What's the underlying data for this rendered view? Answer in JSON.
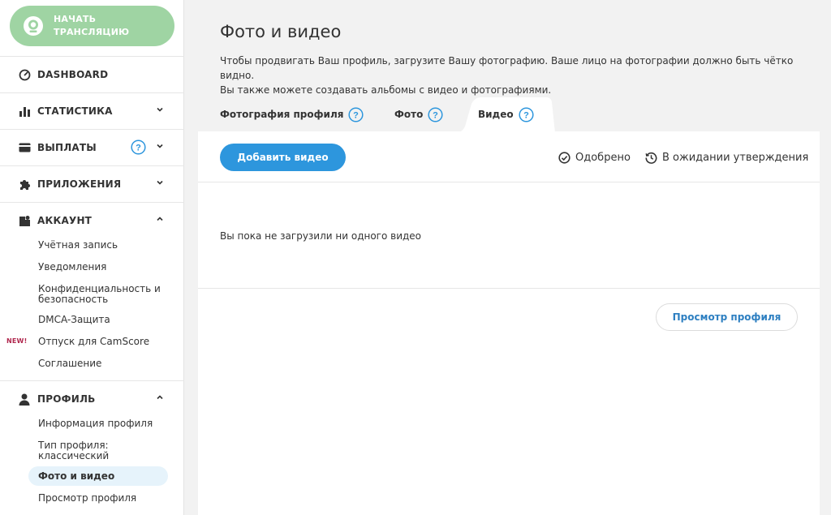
{
  "sidebar": {
    "stream_button": {
      "line1": "НАЧАТЬ",
      "line2": "ТРАНСЛЯЦИЮ"
    },
    "sections": {
      "dashboard": "DASHBOARD",
      "stats": "СТАТИСТИКА",
      "payouts": "ВЫПЛАТЫ",
      "apps": "ПРИЛОЖЕНИЯ",
      "account": "АККАУНТ",
      "profile": "ПРОФИЛЬ"
    },
    "account_items": {
      "account": "Учётная запись",
      "notifications": "Уведомления",
      "privacy_line1": "Конфиденциальность и",
      "privacy_line2": "безопасность",
      "dmca": "DMCA-Защита",
      "camscore": "Отпуск для CamScore",
      "agreement": "Соглашение"
    },
    "new_badge": "NEW!",
    "profile_items": {
      "info": "Информация профиля",
      "type_line1": "Тип профиля:",
      "type_line2": "классический",
      "photos": "Фото и видео",
      "view": "Просмотр профиля"
    }
  },
  "main": {
    "title": "Фото и видео",
    "desc_line1": "Чтобы продвигать Ваш профиль, загрузите Вашу фотографию. Ваше лицо на фотографии должно быть чётко видно.",
    "desc_line2": "Вы также можете создавать альбомы с видео и фотографиями.",
    "tabs": {
      "profile_photo": "Фотография профиля",
      "photo": "Фото",
      "video": "Видео"
    },
    "add_video": "Добавить видео",
    "approved": "Одобрено",
    "pending": "В ожидании утверждения",
    "empty": "Вы пока не загрузили ни одного видео",
    "view_profile": "Просмотр профиля"
  },
  "colors": {
    "accent": "#2d96dd",
    "stream": "#9fd4a3",
    "badge": "#b0264d"
  }
}
